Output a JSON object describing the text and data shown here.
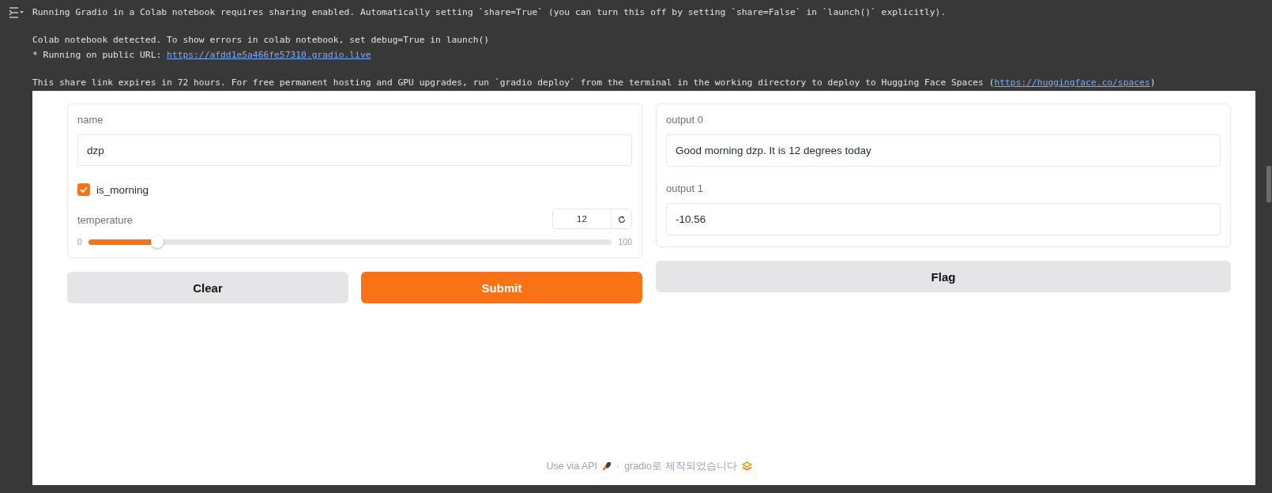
{
  "cell_output": {
    "paragraphs": [
      [
        {
          "text": "Running Gradio in a Colab notebook requires sharing enabled. Automatically setting `share=True` (you can turn this off by setting `share=False` in `launch()` explicitly)."
        }
      ],
      [
        {
          "text": "Colab notebook detected. To show errors in colab notebook, set debug=True in launch()"
        },
        {
          "text": "* Running on public URL: ",
          "link": "https://afdd1e5a466fe57310.gradio.live"
        }
      ],
      [
        {
          "text": "This share link expires in 72 hours. For free permanent hosting and GPU upgrades, run `gradio deploy` from the terminal in the working directory to deploy to Hugging Face Spaces (",
          "link": "https://huggingface.co/spaces",
          "after": ")"
        }
      ]
    ]
  },
  "gradio_app": {
    "inputs": [
      {
        "kind": "textbox",
        "label": "name",
        "value": "dzp"
      },
      {
        "kind": "checkbox",
        "label": "is_morning",
        "checked": true
      },
      {
        "kind": "slider",
        "label": "temperature",
        "value": "12",
        "min": "0",
        "max": "100",
        "level": 0.12
      }
    ],
    "input_buttons": [
      {
        "label": "Clear",
        "kind": "secondary"
      },
      {
        "label": "Submit",
        "kind": "primary"
      }
    ],
    "outputs": [
      {
        "label": "output 0",
        "value": "Good morning dzp. It is 12 degrees today"
      },
      {
        "label": "output 1",
        "value": "-10.56"
      }
    ],
    "output_buttons": [
      {
        "label": "Flag",
        "kind": "secondary"
      }
    ],
    "footer": {
      "api_link": "Use via API",
      "separator": "·",
      "built_with": "gradio로 제작되었습니다"
    }
  }
}
